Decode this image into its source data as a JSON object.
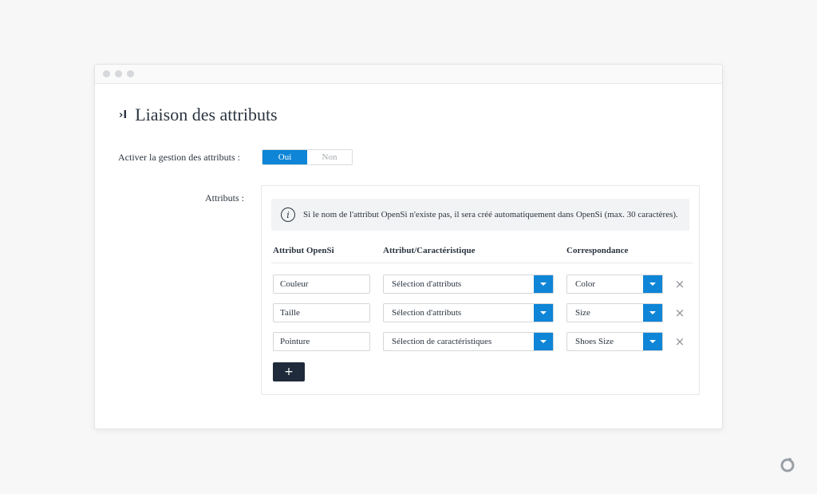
{
  "page": {
    "title": "Liaison des attributs",
    "title_icon": "›I"
  },
  "form": {
    "enable_label": "Activer la gestion des attributs :",
    "toggle_on": "Oui",
    "toggle_off": "Non",
    "attributes_label": "Attributs :"
  },
  "info": {
    "icon": "i",
    "text": "Si le nom de l'attribut OpenSi n'existe pas, il sera créé automatiquement dans OpenSi (max. 30 caractères)."
  },
  "table": {
    "headers": [
      "Attribut OpenSi",
      "Attribut/Caractéristique",
      "Correspondance"
    ],
    "rows": [
      {
        "opensi": "Couleur",
        "type": "Sélection d'attributs",
        "match": "Color"
      },
      {
        "opensi": "Taille",
        "type": "Sélection d'attributs",
        "match": "Size"
      },
      {
        "opensi": "Pointure",
        "type": "Sélection de caractéristiques",
        "match": "Shoes Size"
      }
    ],
    "remove_icon": "×",
    "add_label": "+"
  },
  "colors": {
    "accent": "#0e85d6",
    "dark": "#1f2a3a"
  }
}
